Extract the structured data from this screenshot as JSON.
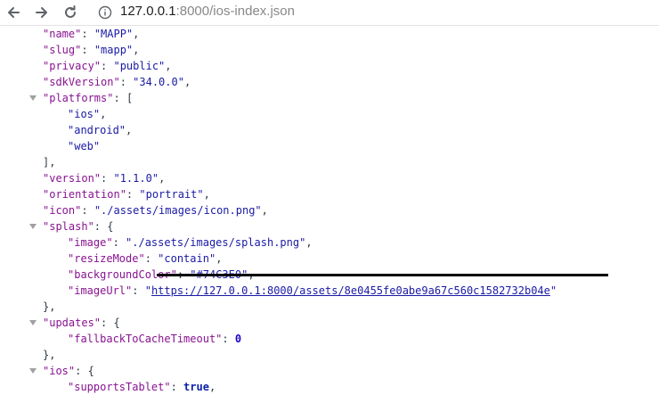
{
  "browser": {
    "url_host": "127.0.0.1",
    "url_rest": ":8000/ios-index.json"
  },
  "json": {
    "name_key": "\"name\"",
    "name_val": "\"MAPP\"",
    "slug_key": "\"slug\"",
    "slug_val": "\"mapp\"",
    "privacy_key": "\"privacy\"",
    "privacy_val": "\"public\"",
    "sdk_key": "\"sdkVersion\"",
    "sdk_val": "\"34.0.0\"",
    "platforms_key": "\"platforms\"",
    "platforms": [
      "\"ios\"",
      "\"android\"",
      "\"web\""
    ],
    "version_key": "\"version\"",
    "version_val": "\"1.1.0\"",
    "orientation_key": "\"orientation\"",
    "orientation_val": "\"portrait\"",
    "icon_key": "\"icon\"",
    "icon_val": "\"./assets/images/icon.png\"",
    "splash_key": "\"splash\"",
    "splash_image_key": "\"image\"",
    "splash_image_val": "\"./assets/images/splash.png\"",
    "resize_key": "\"resizeMode\"",
    "resize_val": "\"contain\"",
    "bg_key": "\"backgroundColor\"",
    "bg_val": "\"#74C3E0\"",
    "imageurl_key": "\"imageUrl\"",
    "imageurl_val": "https://127.0.0.1:8000/assets/8e0455fe0abe9a67c560c1582732b04e",
    "updates_key": "\"updates\"",
    "fallback_key": "\"fallbackToCacheTimeout\"",
    "fallback_val": "0",
    "ios_key": "\"ios\"",
    "tablet_key": "\"supportsTablet\"",
    "tablet_val": "true"
  },
  "punct": {
    "colon": ": ",
    "comma": ",",
    "open_obj": "{",
    "open_arr": "[",
    "close_arr": "],",
    "close_obj": "},",
    "quote": "\""
  },
  "colors": {
    "key": "#881391",
    "string": "#1a1aa6",
    "number": "#1c00cf",
    "annotation": "#000000"
  },
  "icons": [
    "back-arrow-icon",
    "forward-arrow-icon",
    "reload-icon",
    "info-icon",
    "disclosure-triangle-icon"
  ]
}
